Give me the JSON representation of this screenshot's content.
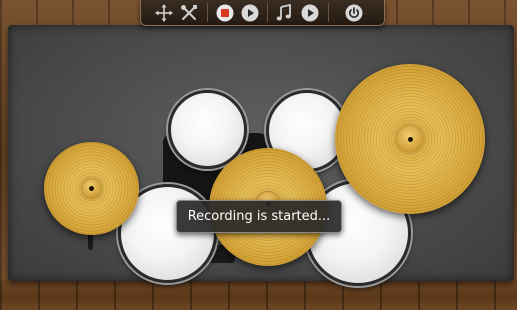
{
  "toolbar": {
    "buttons": [
      {
        "icon": "move-icon",
        "label": ""
      },
      {
        "icon": "tools-icon",
        "label": ""
      },
      {
        "icon": "record-icon",
        "label": ""
      },
      {
        "icon": "play-icon",
        "label": ""
      },
      {
        "icon": "music-note-icon",
        "label": ""
      },
      {
        "icon": "play-icon",
        "label": ""
      },
      {
        "icon": "power-icon",
        "label": ""
      }
    ]
  },
  "toast": {
    "message": "Recording is started..."
  },
  "colors": {
    "record_red": "#d9371f",
    "cymbal_gold": "#d9aa3e",
    "drum_head": "#f4f4f4"
  }
}
